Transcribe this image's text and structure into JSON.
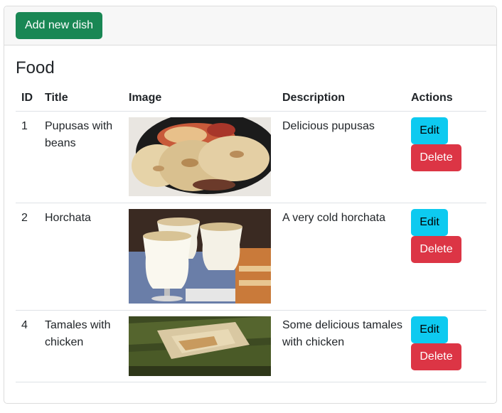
{
  "header": {
    "add_button_label": "Add new dish"
  },
  "page_title": "Food",
  "table": {
    "columns": [
      "ID",
      "Title",
      "Image",
      "Description",
      "Actions"
    ],
    "rows": [
      {
        "id": "1",
        "title": "Pupusas with beans",
        "image": "pupusas-photo",
        "description": "Delicious pupusas",
        "edit_label": "Edit",
        "delete_label": "Delete"
      },
      {
        "id": "2",
        "title": "Horchata",
        "image": "horchata-photo",
        "description": "A very cold horchata",
        "edit_label": "Edit",
        "delete_label": "Delete"
      },
      {
        "id": "4",
        "title": "Tamales with chicken",
        "image": "tamales-photo",
        "description": "Some delicious tamales with chicken",
        "edit_label": "Edit",
        "delete_label": "Delete"
      }
    ]
  },
  "colors": {
    "success": "#198754",
    "info": "#0dcaf0",
    "danger": "#dc3545"
  }
}
